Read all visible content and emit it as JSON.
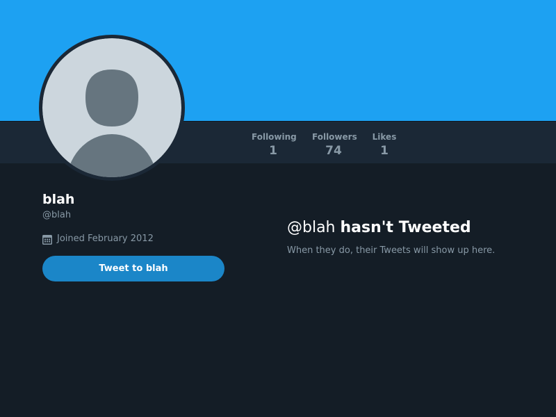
{
  "colors": {
    "banner": "#1da1f2",
    "nav_bar": "#1b2836",
    "page_background": "#141d26",
    "button": "#1b86c8",
    "muted_text": "#8899a6"
  },
  "profile": {
    "name": "blah",
    "handle": "@blah",
    "joined": "Joined February 2012",
    "avatar_icon": "default-avatar-icon",
    "calendar_icon": "calendar-icon"
  },
  "stats": [
    {
      "label": "Following",
      "value": "1"
    },
    {
      "label": "Followers",
      "value": "74"
    },
    {
      "label": "Likes",
      "value": "1"
    }
  ],
  "actions": {
    "tweet_to_label": "Tweet to blah"
  },
  "empty_state": {
    "handle": "@blah",
    "title_rest": "hasn't Tweeted",
    "subtitle": "When they do, their Tweets will show up here."
  }
}
